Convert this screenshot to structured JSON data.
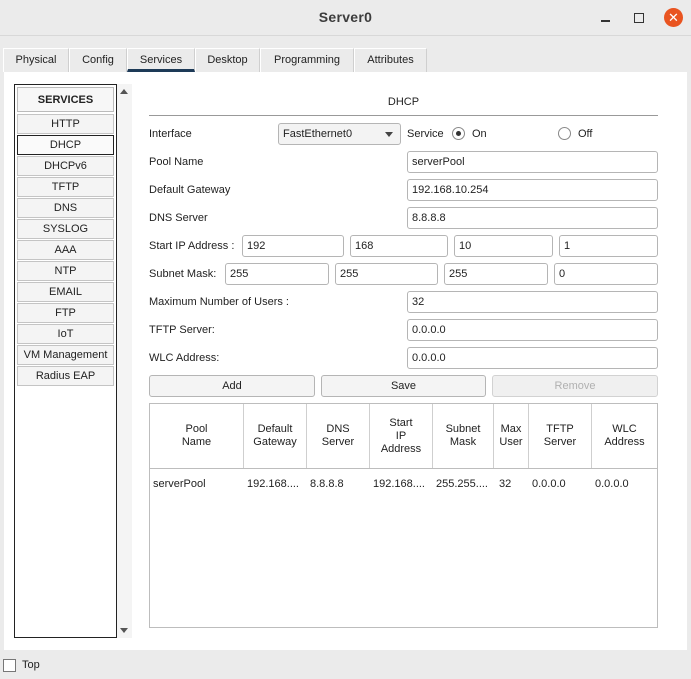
{
  "window": {
    "title": "Server0"
  },
  "tabs": [
    "Physical",
    "Config",
    "Services",
    "Desktop",
    "Programming",
    "Attributes"
  ],
  "services": {
    "header": "SERVICES",
    "items": [
      "HTTP",
      "DHCP",
      "DHCPv6",
      "TFTP",
      "DNS",
      "SYSLOG",
      "AAA",
      "NTP",
      "EMAIL",
      "FTP",
      "IoT",
      "VM Management",
      "Radius EAP"
    ],
    "selected": "DHCP"
  },
  "dhcp": {
    "title": "DHCP",
    "interface_label": "Interface",
    "interface_value": "FastEthernet0",
    "service_label": "Service",
    "on_label": "On",
    "off_label": "Off",
    "service_state": "On",
    "pool_name_label": "Pool Name",
    "pool_name": "serverPool",
    "gateway_label": "Default Gateway",
    "gateway": "192.168.10.254",
    "dns_label": "DNS Server",
    "dns": "8.8.8.8",
    "start_ip_label": "Start IP Address :",
    "start_ip": [
      "192",
      "168",
      "10",
      "1"
    ],
    "subnet_label": "Subnet Mask:",
    "subnet": [
      "255",
      "255",
      "255",
      "0"
    ],
    "max_users_label": "Maximum Number of Users :",
    "max_users": "32",
    "tftp_label": "TFTP Server:",
    "tftp": "0.0.0.0",
    "wlc_label": "WLC Address:",
    "wlc": "0.0.0.0",
    "buttons": {
      "add": "Add",
      "save": "Save",
      "remove": "Remove"
    },
    "table": {
      "headers": [
        "Pool\nName",
        "Default\nGateway",
        "DNS\nServer",
        "Start\nIP\nAddress",
        "Subnet\nMask",
        "Max\nUser",
        "TFTP\nServer",
        "WLC\nAddress"
      ],
      "rows": [
        [
          "serverPool",
          "192.168....",
          "8.8.8.8",
          "192.168....",
          "255.255....",
          "32",
          "0.0.0.0",
          "0.0.0.0"
        ]
      ]
    }
  },
  "footer": {
    "top_label": "Top",
    "top_checked": false
  }
}
